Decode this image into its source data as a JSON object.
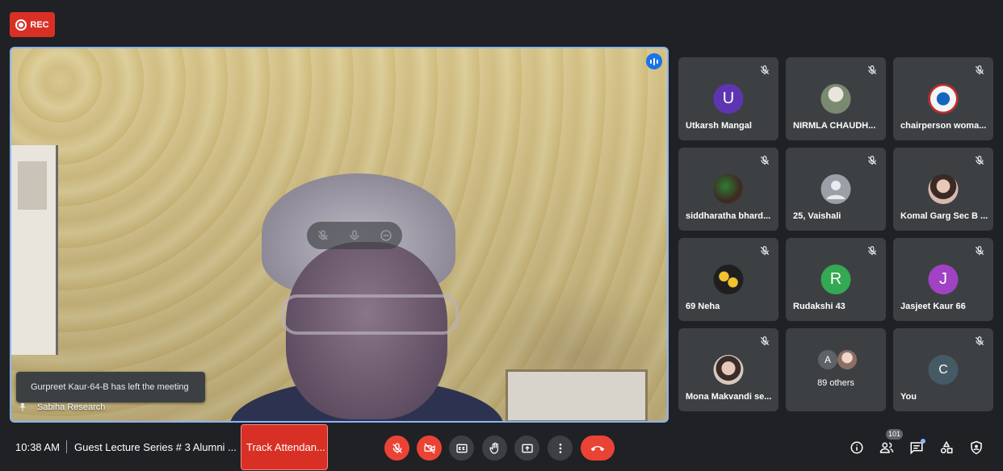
{
  "recording": {
    "label": "REC",
    "icon": "record-icon"
  },
  "main_video": {
    "participant_name": "Sabiha Research",
    "toast": "Gurpreet Kaur-64-B has left the meeting"
  },
  "tiles": [
    {
      "name": "Utkarsh Mangal",
      "initial": "U",
      "color": "#5e35b1"
    },
    {
      "name": "NIRMLA CHAUDH...",
      "initial": "",
      "color": "#7a8a70"
    },
    {
      "name": "chairperson woma...",
      "initial": "",
      "color": "#e8eaf6"
    },
    {
      "name": "siddharatha bhard...",
      "initial": "",
      "color": "#4a5a3a"
    },
    {
      "name": "25, Vaishali",
      "initial": "",
      "color": "#9aa0a6"
    },
    {
      "name": "Komal Garg Sec B ...",
      "initial": "",
      "color": "#d9b8b0"
    },
    {
      "name": "69 Neha",
      "initial": "",
      "color": "#1f1f1f"
    },
    {
      "name": "Rudakshi 43",
      "initial": "R",
      "color": "#34a853"
    },
    {
      "name": "Jasjeet Kaur 66",
      "initial": "J",
      "color": "#a142c4"
    },
    {
      "name": "Mona Makvandi se...",
      "initial": "",
      "color": "#d8c8c0"
    },
    {
      "name": "You",
      "initial": "C",
      "color": "#455a64"
    }
  ],
  "others": {
    "count_label": "89 others",
    "initial": "A"
  },
  "bottom_bar": {
    "time": "10:38 AM",
    "meeting_title": "Guest Lecture Series # 3 Alumni ...",
    "track_attendance": "Track Attendan...",
    "people_count": "101"
  },
  "colors": {
    "accent": "#8ab4f8",
    "danger": "#ea4335",
    "surface": "#3c4043",
    "background": "#202124"
  }
}
